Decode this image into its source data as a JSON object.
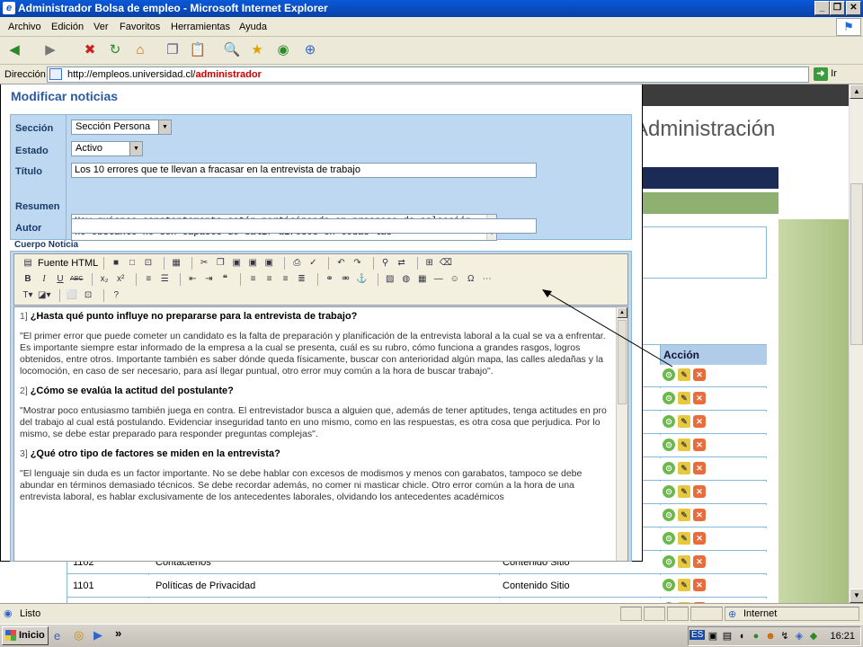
{
  "window": {
    "title": "Administrador Bolsa de empleo - Microsoft Internet Explorer"
  },
  "menu": [
    "Archivo",
    "Edición",
    "Ver",
    "Favoritos",
    "Herramientas",
    "Ayuda"
  ],
  "address": {
    "label": "Dirección",
    "url_base": "http://empleos.universidad.cl/",
    "url_highlight": "administrador",
    "go": "Ir"
  },
  "background_page": {
    "heading": "Administración",
    "action_header": "Acción",
    "rows": [
      {
        "id": "1102",
        "name": "Contactenos",
        "type": "Contenido Sitio"
      },
      {
        "id": "1101",
        "name": "Políticas de Privacidad",
        "type": "Contenido Sitio"
      }
    ]
  },
  "popup": {
    "title": "Modificar noticias",
    "labels": {
      "seccion": "Sección",
      "estado": "Estado",
      "titulo": "Título",
      "resumen": "Resumen",
      "autor": "Autor",
      "cuerpo": "Cuerpo Noticia"
    },
    "seccion_value": "Sección Persona",
    "estado_value": "Activo",
    "titulo_value": "Los 10 errores que te llevan a fracasar en la entrevista de trabajo",
    "resumen_value": "Hay quienes constantemente están participando en procesos de selección, no obstante no son capaces de salir airosos en todas las",
    "autor_value": "",
    "editor": {
      "source_label": "Fuente HTML",
      "q1_num": "1]",
      "q1": "¿Hasta qué punto influye no prepararse para la entrevista de trabajo?",
      "p1": "\"El primer error que puede cometer un candidato es la falta de preparación y planificación de la entrevista laboral a la cual se va a enfrentar. Es importante siempre estar informado de la empresa a la cual se presenta, cuál es su rubro, cómo funciona a grandes rasgos, logros obtenidos, entre otros. Importante también es saber dónde queda físicamente, buscar con anterioridad algún mapa, las calles aledañas y la locomoción, en caso de ser necesario, para así llegar puntual, otro error muy común a la hora de buscar trabajo\".",
      "q2_num": "2]",
      "q2": "¿Cómo se evalúa la actitud del postulante?",
      "p2": "\"Mostrar poco entusiasmo también juega en contra. El entrevistador busca a alguien que, además de tener aptitudes, tenga actitudes en pro del trabajo al cual está postulando. Evidenciar inseguridad tanto en uno mismo, como en las respuestas, es otra cosa que perjudica. Por lo mismo, se debe estar preparado para responder preguntas complejas\".",
      "q3_num": "3]",
      "q3": "¿Qué otro tipo de factores se miden en la entrevista?",
      "p3": "\"El lenguaje sin duda es un factor importante. No se debe hablar con excesos de modismos y menos con garabatos, tampoco se debe abundar en términos demasiado técnicos. Se debe recordar además, no comer ni masticar chicle. Otro error común a la hora de una entrevista laboral, es hablar exclusivamente de los antecedentes laborales, olvidando los antecedentes académicos"
    }
  },
  "status": {
    "text": "Listo",
    "zone": "Internet"
  },
  "taskbar": {
    "start": "Inicio",
    "more": "»",
    "lang": "ES",
    "clock": "16:21"
  }
}
